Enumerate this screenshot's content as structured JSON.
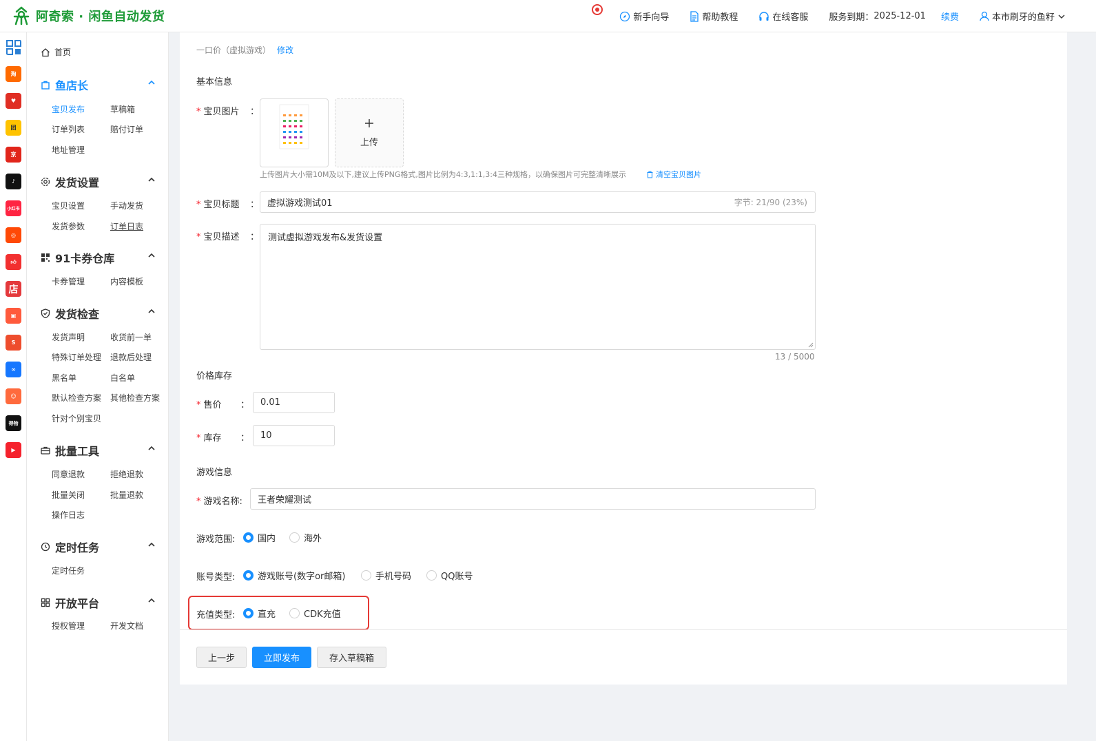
{
  "header": {
    "app_title": "阿奇索 · 闲鱼自动发货",
    "guide": "新手向导",
    "help": "帮助教程",
    "service": "在线客服",
    "expire_label": "服务到期：",
    "expire_date": "2025-12-01",
    "renew": "续费",
    "user": "本市刷牙的鱼籽"
  },
  "rail": [
    "grid",
    "taobao",
    "pinduoduo",
    "meituan",
    "jingdong",
    "douyin",
    "xiaohongshu",
    "kuaishou",
    "like",
    "dian",
    "shop-bag",
    "shopee",
    "link",
    "face",
    "dewu",
    "video"
  ],
  "sidebar": {
    "home": "首页",
    "groups": [
      {
        "title": "鱼店长",
        "items": [
          "宝贝发布",
          "草稿箱",
          "订单列表",
          "赔付订单",
          "地址管理"
        ]
      },
      {
        "title": "发货设置",
        "items": [
          "宝贝设置",
          "手动发货",
          "发货参数",
          "订单日志"
        ]
      },
      {
        "title": "91卡券仓库",
        "items": [
          "卡券管理",
          "内容模板"
        ]
      },
      {
        "title": "发货检查",
        "items": [
          "发货声明",
          "收货前一单",
          "特殊订单处理",
          "退款后处理",
          "黑名单",
          "白名单",
          "默认检查方案",
          "其他检查方案",
          "针对个别宝贝"
        ]
      },
      {
        "title": "批量工具",
        "items": [
          "同意退款",
          "拒绝退款",
          "批量关闭",
          "批量退款",
          "操作日志"
        ]
      },
      {
        "title": "定时任务",
        "items": [
          "定时任务"
        ]
      },
      {
        "title": "开放平台",
        "items": [
          "授权管理",
          "开发文档"
        ]
      }
    ]
  },
  "form": {
    "price_type": "一口价（虚拟游戏）",
    "modify": "修改",
    "basic_info": "基本信息",
    "image_label": "宝贝图片",
    "upload": "上传",
    "upload_tip": "上传图片大小需10M及以下,建议上传PNG格式,图片比例为4:3,1:1,3:4三种规格，以确保图片可完整清晰展示",
    "clear_images": "清空宝贝图片",
    "title_label": "宝贝标题",
    "title_value": "虚拟游戏测试01",
    "title_count": "字节: 21/90 (23%)",
    "desc_label": "宝贝描述",
    "desc_value": "测试虚拟游戏发布&发货设置",
    "desc_count": "13 / 5000",
    "price_stock": "价格库存",
    "price_label": "售价",
    "price_value": "0.01",
    "stock_label": "库存",
    "stock_value": "10",
    "game_info": "游戏信息",
    "game_name_label": "游戏名称:",
    "game_name_value": "王者荣耀测试",
    "range_label": "游戏范围:",
    "range_options": [
      "国内",
      "海外"
    ],
    "account_label": "账号类型:",
    "account_options": [
      "游戏账号(数字or邮箱)",
      "手机号码",
      "QQ账号"
    ],
    "recharge_label": "充值类型:",
    "recharge_options": [
      "直充",
      "CDK充值"
    ],
    "colon": "："
  },
  "actions": {
    "prev": "上一步",
    "publish": "立即发布",
    "draft": "存入草稿箱"
  }
}
